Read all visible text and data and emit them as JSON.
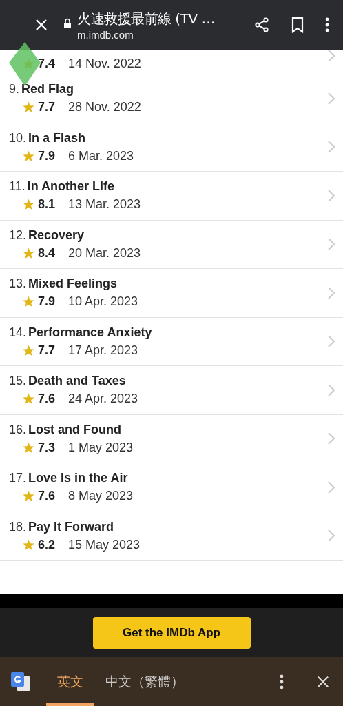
{
  "browser_bar": {
    "title": "火速救援最前線 (TV …",
    "url": "m.imdb.com"
  },
  "episodes": [
    {
      "rating": "7.4",
      "date": "14 Nov. 2022"
    },
    {
      "number": "9.",
      "title": "Red Flag",
      "rating": "7.7",
      "date": "28 Nov. 2022"
    },
    {
      "number": "10.",
      "title": "In a Flash",
      "rating": "7.9",
      "date": "6 Mar. 2023"
    },
    {
      "number": "11.",
      "title": "In Another Life",
      "rating": "8.1",
      "date": "13 Mar. 2023"
    },
    {
      "number": "12.",
      "title": "Recovery",
      "rating": "8.4",
      "date": "20 Mar. 2023"
    },
    {
      "number": "13.",
      "title": "Mixed Feelings",
      "rating": "7.9",
      "date": "10 Apr. 2023"
    },
    {
      "number": "14.",
      "title": "Performance Anxiety",
      "rating": "7.7",
      "date": "17 Apr. 2023"
    },
    {
      "number": "15.",
      "title": "Death and Taxes",
      "rating": "7.6",
      "date": "24 Apr. 2023"
    },
    {
      "number": "16.",
      "title": "Lost and Found",
      "rating": "7.3",
      "date": "1 May 2023"
    },
    {
      "number": "17.",
      "title": "Love Is in the Air",
      "rating": "7.6",
      "date": "8 May 2023"
    },
    {
      "number": "18.",
      "title": "Pay It Forward",
      "rating": "6.2",
      "date": "15 May 2023"
    }
  ],
  "app_button": "Get the IMDb App",
  "translate_bar": {
    "tabs": [
      {
        "label": "英文",
        "selected": true
      },
      {
        "label": "中文（繁體）",
        "selected": false
      }
    ]
  }
}
